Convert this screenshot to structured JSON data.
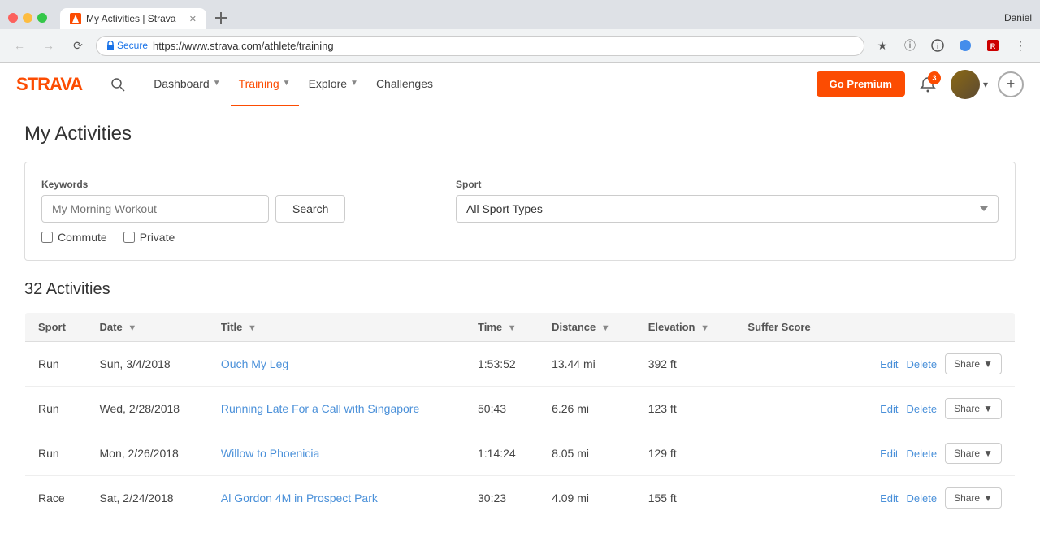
{
  "browser": {
    "user": "Daniel",
    "tab_title": "My Activities | Strava",
    "url": "https://www.strava.com/athlete/training",
    "url_display": "https://www.strava.com/athlete/training",
    "secure_label": "Secure"
  },
  "nav": {
    "logo": "STRAVA",
    "links": [
      {
        "id": "dashboard",
        "label": "Dashboard",
        "has_arrow": true,
        "active": false
      },
      {
        "id": "training",
        "label": "Training",
        "has_arrow": true,
        "active": true
      },
      {
        "id": "explore",
        "label": "Explore",
        "has_arrow": true,
        "active": false
      },
      {
        "id": "challenges",
        "label": "Challenges",
        "has_arrow": false,
        "active": false
      }
    ],
    "premium_label": "Go Premium",
    "notifications_count": "3",
    "user_dropdown_arrow": "▾"
  },
  "page": {
    "title": "My Activities"
  },
  "filters": {
    "keywords_label": "Keywords",
    "keywords_placeholder": "My Morning Workout",
    "search_label": "Search",
    "sport_label": "Sport",
    "sport_default": "All Sport Types",
    "commute_label": "Commute",
    "private_label": "Private"
  },
  "activities": {
    "count_label": "32 Activities",
    "columns": {
      "sport": "Sport",
      "date": "Date",
      "title": "Title",
      "time": "Time",
      "distance": "Distance",
      "elevation": "Elevation",
      "suffer_score": "Suffer Score"
    },
    "rows": [
      {
        "sport": "Run",
        "date": "Sun, 3/4/2018",
        "title": "Ouch My Leg",
        "time": "1:53:52",
        "distance": "13.44 mi",
        "elevation": "392 ft"
      },
      {
        "sport": "Run",
        "date": "Wed, 2/28/2018",
        "title": "Running Late For a Call with Singapore",
        "time": "50:43",
        "distance": "6.26 mi",
        "elevation": "123 ft"
      },
      {
        "sport": "Run",
        "date": "Mon, 2/26/2018",
        "title": "Willow to Phoenicia",
        "time": "1:14:24",
        "distance": "8.05 mi",
        "elevation": "129 ft"
      },
      {
        "sport": "Race",
        "date": "Sat, 2/24/2018",
        "title": "Al Gordon 4M in Prospect Park",
        "time": "30:23",
        "distance": "4.09 mi",
        "elevation": "155 ft"
      }
    ],
    "edit_label": "Edit",
    "delete_label": "Delete",
    "share_label": "Share"
  }
}
